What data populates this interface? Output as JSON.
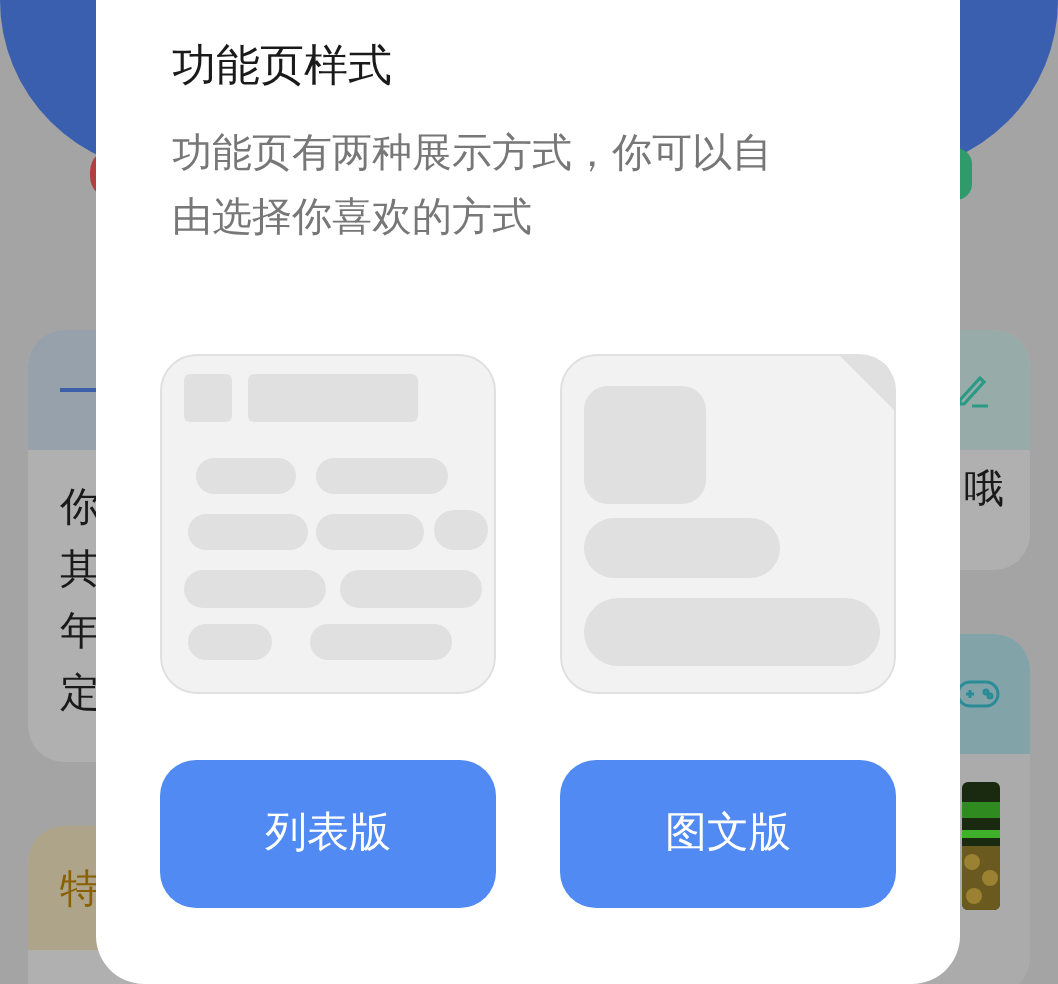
{
  "background": {
    "left_cards": [
      {
        "kind": "text",
        "lines": [
          "你",
          "其",
          "年",
          "定"
        ]
      },
      {
        "kind": "label",
        "label": "特"
      }
    ],
    "right_cards": [
      {
        "kind": "text",
        "lines": [
          "哦"
        ]
      },
      {
        "kind": "picture"
      }
    ]
  },
  "dialog": {
    "title": "功能页样式",
    "description": "功能页有两种展示方式，你可以自由选择你喜欢的方式",
    "buttons": [
      "列表版",
      "图文版"
    ]
  }
}
